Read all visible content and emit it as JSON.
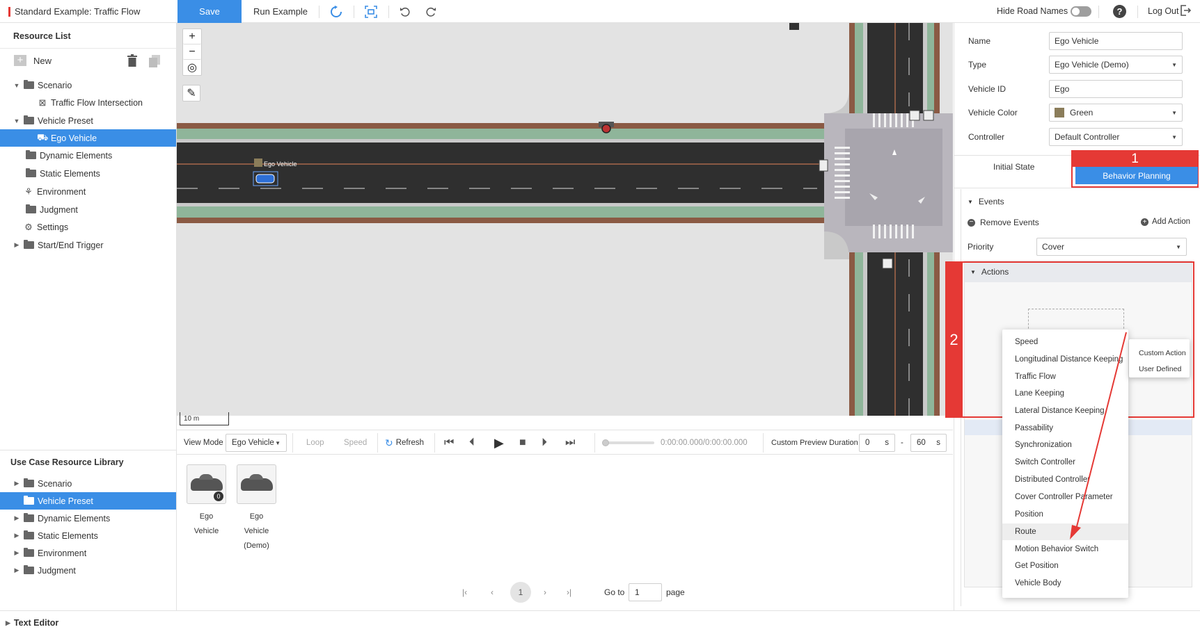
{
  "topbar": {
    "title": "Standard Example: Traffic Flow",
    "save_label": "Save",
    "run_label": "Run Example",
    "hide_road_names_label": "Hide Road Names",
    "help_label": "?",
    "logout_label": "Log Out"
  },
  "resource_list": {
    "title": "Resource List",
    "new_label": "New",
    "items": [
      {
        "label": "Scenario",
        "type": "folder-open",
        "expanded": true
      },
      {
        "label": "Traffic Flow Intersection",
        "type": "scenario"
      },
      {
        "label": "Vehicle Preset",
        "type": "folder-open",
        "expanded": true
      },
      {
        "label": "Ego Vehicle",
        "type": "vehicle",
        "selected": true
      },
      {
        "label": "Dynamic Elements",
        "type": "folder"
      },
      {
        "label": "Static Elements",
        "type": "folder"
      },
      {
        "label": "Environment",
        "type": "environment"
      },
      {
        "label": "Judgment",
        "type": "folder"
      },
      {
        "label": "Settings",
        "type": "settings"
      },
      {
        "label": "Start/End Trigger",
        "type": "folder"
      }
    ]
  },
  "library": {
    "title": "Use Case Resource Library",
    "items": [
      {
        "label": "Scenario"
      },
      {
        "label": "Vehicle Preset",
        "selected": true
      },
      {
        "label": "Dynamic Elements"
      },
      {
        "label": "Static Elements"
      },
      {
        "label": "Environment"
      },
      {
        "label": "Judgment"
      }
    ]
  },
  "map": {
    "vehicle_label": "Ego Vehicle",
    "scale_label": "10 m",
    "zoom_in": "+",
    "zoom_out": "−"
  },
  "controls": {
    "view_mode_label": "View Mode",
    "view_mode_value": "Ego Vehicle",
    "loop_label": "Loop",
    "speed_label": "Speed",
    "refresh_label": "Refresh",
    "time_display": "0:00:00.000/0:00:00.000",
    "preview_duration_label": "Custom Preview Duration",
    "duration_start": "0",
    "duration_end": "60",
    "unit_s": "s",
    "dash": "-"
  },
  "cards": [
    {
      "label_line1": "Ego Vehicle",
      "label_line2": "",
      "badge": "0"
    },
    {
      "label_line1": "Ego Vehicle",
      "label_line2": "(Demo)"
    }
  ],
  "pager": {
    "current_page": "1",
    "goto_label": "Go to",
    "goto_value": "1",
    "page_label": "page"
  },
  "bottom": {
    "text_editor_label": "Text Editor"
  },
  "properties": {
    "name_label": "Name",
    "name_value": "Ego Vehicle",
    "type_label": "Type",
    "type_value": "Ego Vehicle (Demo)",
    "vehicle_id_label": "Vehicle ID",
    "vehicle_id_value": "Ego",
    "vehicle_color_label": "Vehicle Color",
    "vehicle_color_value": "Green",
    "vehicle_color_swatch": "#8b7d5a",
    "controller_label": "Controller",
    "controller_value": "Default Controller"
  },
  "tabs": {
    "initial_state": "Initial State",
    "behavior_planning": "Behavior Planning"
  },
  "events": {
    "events_label": "Events",
    "remove_events_label": "Remove Events",
    "add_action_label": "Add Action",
    "priority_label": "Priority",
    "priority_value": "Cover",
    "actions_label": "Actions"
  },
  "annotations": {
    "marker1": "1",
    "marker2": "2"
  },
  "action_menu": [
    "Speed",
    "Longitudinal Distance Keeping",
    "Traffic Flow",
    "Lane Keeping",
    "Lateral Distance Keeping",
    "Passability",
    "Synchronization",
    "Switch Controller",
    "Distributed Controller",
    "Cover Controller Parameter",
    "Position",
    "Route",
    "Motion Behavior Switch",
    "Get Position",
    "Vehicle Body"
  ],
  "sub_menu": [
    "Custom Action",
    "User Defined"
  ],
  "colors": {
    "accent": "#3a8ee6",
    "annotation_red": "#e53935",
    "road": "#2f2f2f",
    "grass": "#8fb59a",
    "curb": "#8a5a44"
  }
}
